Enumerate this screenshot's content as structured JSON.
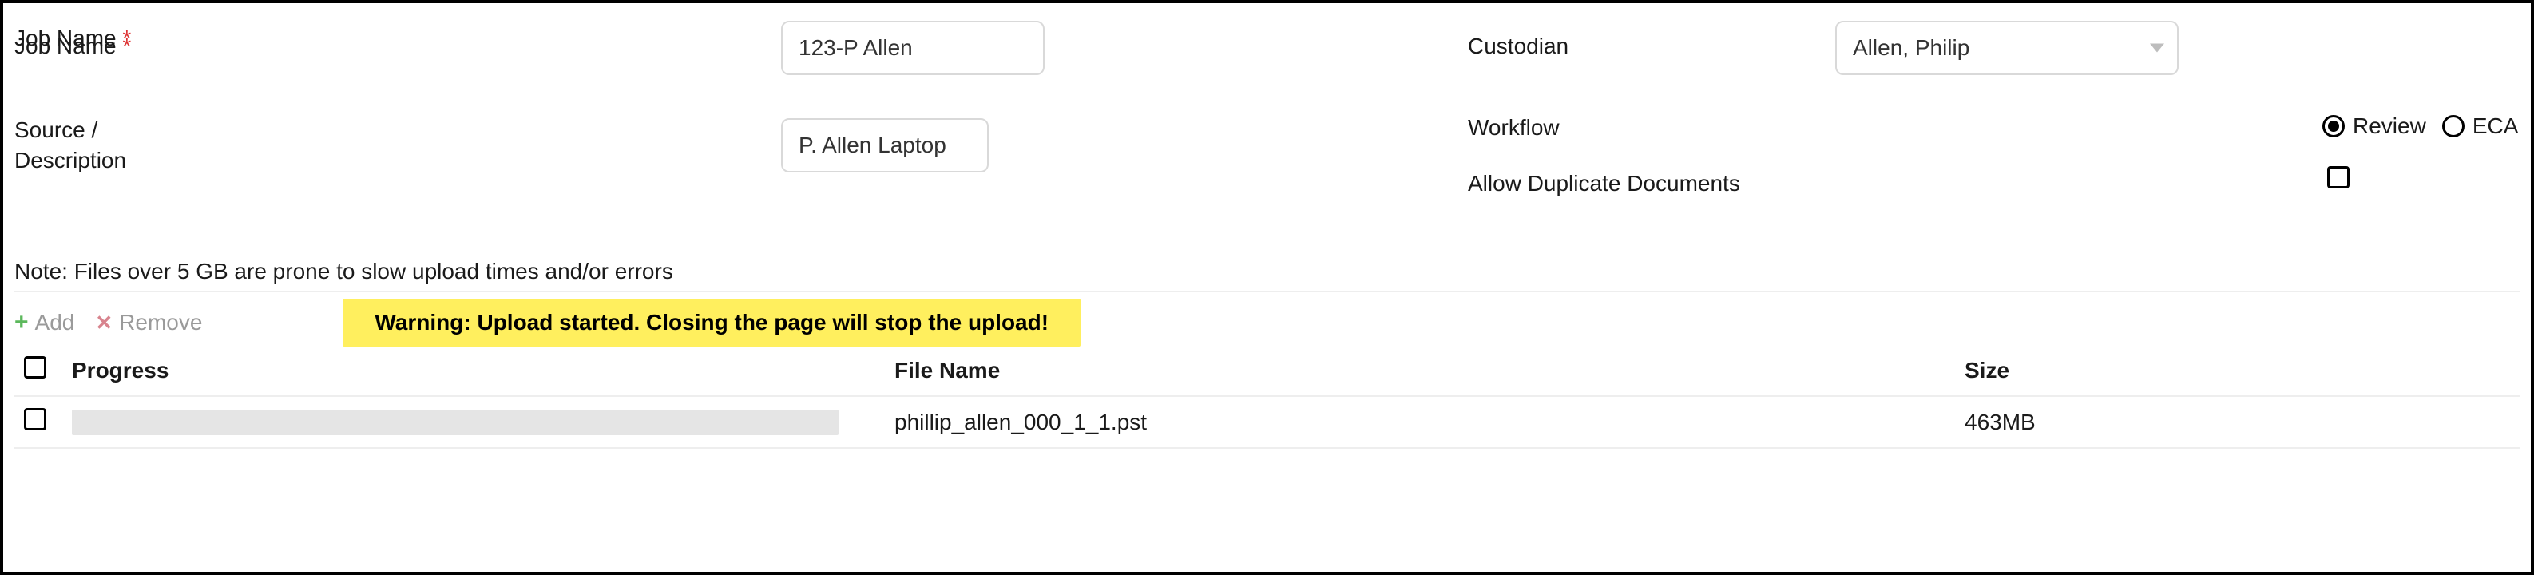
{
  "form": {
    "jobName": {
      "label": "Job Name",
      "required": "*",
      "value": "123-P Allen"
    },
    "custodian": {
      "label": "Custodian",
      "value": "Allen, Philip"
    },
    "sourceDescription": {
      "label": "Source / Description",
      "value": "P. Allen Laptop"
    },
    "workflow": {
      "label": "Workflow",
      "options": {
        "review": "Review",
        "eca": "ECA"
      },
      "selected": "review"
    },
    "allowDuplicates": {
      "label": "Allow Duplicate Documents",
      "checked": false
    }
  },
  "note": "Note: Files over 5 GB are prone to slow upload times and/or errors",
  "toolbar": {
    "add": "Add",
    "remove": "Remove"
  },
  "warning": "Warning: Upload started. Closing the page will stop the upload!",
  "table": {
    "headers": {
      "progress": "Progress",
      "fileName": "File Name",
      "size": "Size"
    },
    "rows": [
      {
        "checked": false,
        "fileName": "phillip_allen_000_1_1.pst",
        "size": "463MB",
        "progressPct": 0
      }
    ]
  }
}
